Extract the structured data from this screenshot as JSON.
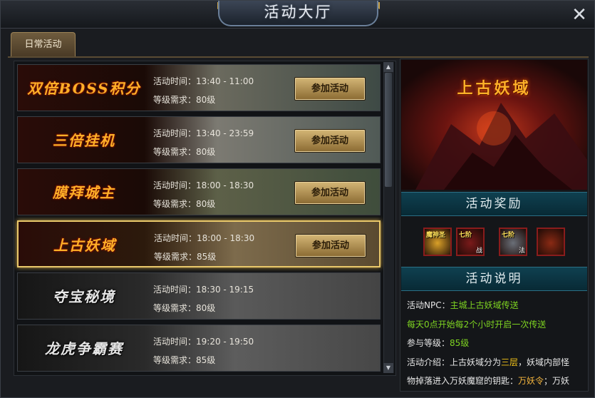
{
  "window": {
    "title": "活动大厅",
    "close_label": "✕"
  },
  "tabs": [
    {
      "label": "日常活动",
      "active": true
    }
  ],
  "activities": [
    {
      "name": "双倍BOSS积分",
      "name_style": "gold",
      "time_label": "活动时间：13:40 - 11:00",
      "level_label": "等级需求：80级",
      "button": "参加活动",
      "selected": false
    },
    {
      "name": "三倍挂机",
      "name_style": "gold",
      "time_label": "活动时间：13:40 - 23:59",
      "level_label": "等级需求：80级",
      "button": "参加活动",
      "selected": false
    },
    {
      "name": "膜拜城主",
      "name_style": "gold",
      "time_label": "活动时间：18:00 - 18:30",
      "level_label": "等级需求：80级",
      "button": "参加活动",
      "selected": false
    },
    {
      "name": "上古妖域",
      "name_style": "gold",
      "time_label": "活动时间：18:00 - 18:30",
      "level_label": "等级需求：85级",
      "button": "参加活动",
      "selected": true
    },
    {
      "name": "夺宝秘境",
      "name_style": "silver",
      "time_label": "活动时间：18:30 - 19:15",
      "level_label": "等级需求：80级",
      "button": "",
      "selected": false
    },
    {
      "name": "龙虎争霸赛",
      "name_style": "silver",
      "time_label": "活动时间：19:20 - 19:50",
      "level_label": "等级需求：85级",
      "button": "",
      "selected": false
    }
  ],
  "detail": {
    "banner_title": "上古妖域",
    "rewards_heading": "活动奖励",
    "rewards": [
      {
        "label": "魔神圣",
        "tag": "",
        "icon": "magic-staff-icon",
        "color": "#d9a028"
      },
      {
        "label": "七阶",
        "tag": "战",
        "icon": "sword-icon",
        "color": "#7a1a1a"
      },
      {
        "label": "七阶",
        "tag": "法",
        "icon": "armor-icon",
        "color": "#6a6f78"
      },
      {
        "label": "",
        "tag": "",
        "icon": "skill-book-icon",
        "color": "#8a2a14"
      }
    ],
    "description_heading": "活动说明",
    "lines": [
      [
        {
          "text": "活动NPC：",
          "color": "white"
        },
        {
          "text": "主城上古妖域传送",
          "color": "green"
        }
      ],
      [
        {
          "text": "每天0点开始每2个小时开启一次传送",
          "color": "green"
        }
      ],
      [
        {
          "text": "参与等级：",
          "color": "white"
        },
        {
          "text": "85级",
          "color": "green"
        }
      ],
      [
        {
          "text": "活动介绍：上古妖域分为",
          "color": "white"
        },
        {
          "text": "三层",
          "color": "yellow"
        },
        {
          "text": "，妖域内部怪",
          "color": "white"
        }
      ],
      [
        {
          "text": "物掉落进入万妖魔窟的钥匙：",
          "color": "white"
        },
        {
          "text": "万妖令",
          "color": "gold"
        },
        {
          "text": "；万妖",
          "color": "white"
        }
      ]
    ]
  },
  "scrollbar": {
    "up": "▲",
    "down": "▼"
  }
}
